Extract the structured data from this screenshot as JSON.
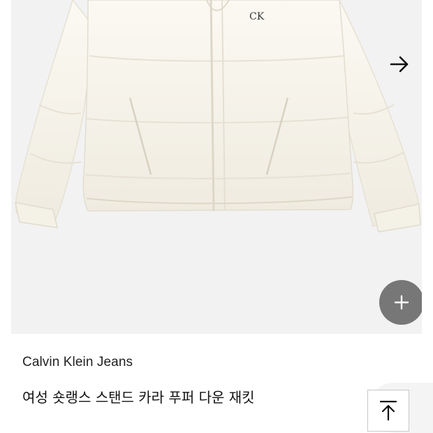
{
  "product": {
    "brand": "Calvin Klein Jeans",
    "name": "여성 숏랭스 스탠드 카라 푸퍼 다운 재킷",
    "image_alt": "White cropped stand-collar puffer down jacket",
    "logo_text": "CK"
  },
  "gallery": {
    "next_icon": "arrow-right-icon",
    "plus_icon": "plus-icon"
  },
  "page": {
    "scroll_top_icon": "arrow-up-to-top-icon"
  },
  "colors": {
    "image_bg": "#f2f2f2",
    "jacket": "#f8f5ec",
    "plus_button": "#777777",
    "text": "#222222"
  }
}
